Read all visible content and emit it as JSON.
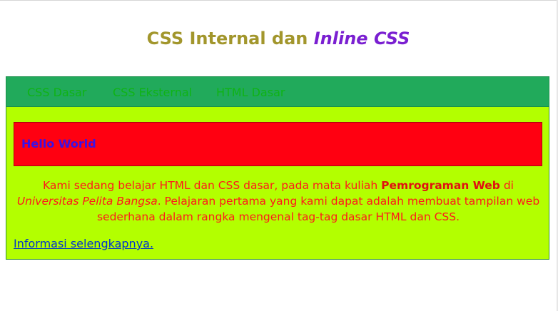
{
  "header": {
    "title_part1": "CSS Internal dan ",
    "title_part2": "Inline CSS"
  },
  "nav": {
    "items": [
      {
        "label": "CSS Dasar"
      },
      {
        "label": "CSS Eksternal"
      },
      {
        "label": "HTML Dasar"
      }
    ]
  },
  "content": {
    "hello": "Hello World",
    "paragraph": {
      "text1": "Kami sedang belajar HTML dan CSS dasar, pada mata kuliah ",
      "bold": "Pemrograman Web",
      "text2": " di ",
      "italic": "Universitas Pelita Bangsa",
      "text3": ". Pelajaran pertama yang kami dapat adalah membuat tampilan web sederhana dalam rangka mengenal tag-tag dasar HTML dan CSS."
    },
    "more_link": "Informasi selengkapnya."
  },
  "colors": {
    "title": "#a2962c",
    "title_inline": "#7a1fd1",
    "navbar_bg": "#21aa5b",
    "nav_link": "#0fb315",
    "content_bg": "#b3ff00",
    "hello_bg": "#ff0011",
    "hello_text": "#3a12e6",
    "paragraph_text": "#ff1a1a",
    "link": "#0033cc"
  }
}
